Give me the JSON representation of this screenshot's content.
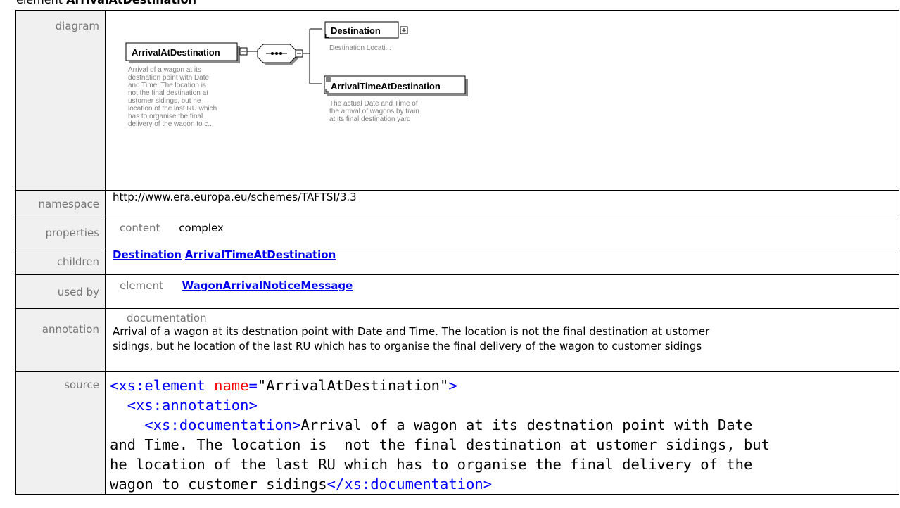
{
  "heading": {
    "prefix": "element",
    "name": "ArrivalAtDestination"
  },
  "rows": {
    "diagram": {
      "label": "diagram",
      "root": {
        "name": "ArrivalAtDestination",
        "doc_lines": [
          "Arrival of a wagon at its",
          "destnation point with Date",
          "and Time. The location is",
          "not the final destination at",
          "ustomer sidings, but he",
          "location of the last RU which",
          "has to organise the final",
          "delivery of the wagon to c..."
        ]
      },
      "children": [
        {
          "name": "Destination",
          "doc_lines": [
            "Destination Locati..."
          ]
        },
        {
          "name": "ArrivalTimeAtDestination",
          "doc_lines": [
            "The actual Date and Time of",
            "the arrival of wagons by train",
            "at its final destination yard"
          ]
        }
      ]
    },
    "namespace": {
      "label": "namespace",
      "value": "http://www.era.europa.eu/schemes/TAFTSI/3.3"
    },
    "properties": {
      "label": "properties",
      "key": "content",
      "value": "complex"
    },
    "children": {
      "label": "children",
      "links": [
        "Destination",
        "ArrivalTimeAtDestination"
      ]
    },
    "used_by": {
      "label": "used by",
      "key": "element",
      "link": "WagonArrivalNoticeMessage"
    },
    "annotation": {
      "label": "annotation",
      "key": "documentation",
      "line1": "Arrival of a wagon at its destnation point with Date and Time. The location is  not the final destination at ustomer",
      "line2": "sidings, but he location of the last RU which has to organise the final delivery of the wagon to customer sidings"
    },
    "source": {
      "label": "source",
      "el_open": "<xs:element",
      "attr_name": " name",
      "attr_eq": "=",
      "attr_val": "\"ArrivalAtDestination\"",
      "el_close": ">",
      "anno_open": "<xs:annotation>",
      "doc_open": "<xs:documentation>",
      "doc_text1": "Arrival of a wagon at its destnation point with Date",
      "doc_text2": "and Time. The location is  not the final destination at ustomer sidings, but",
      "doc_text3": "he location of the last RU which has to organise the final delivery of the",
      "doc_text4": "wagon to customer sidings",
      "doc_close": "</xs:documentation>"
    }
  }
}
